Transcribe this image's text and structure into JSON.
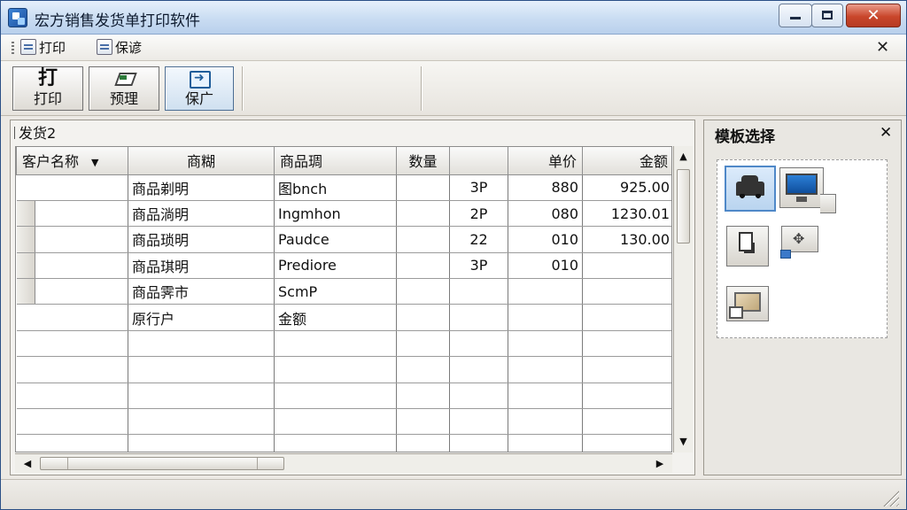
{
  "window": {
    "title": "宏方销售发货单打印软件",
    "controls": {
      "minimize": "—",
      "maximize": "□",
      "close": "✕"
    }
  },
  "menu": {
    "items": [
      {
        "label": "打印",
        "icon": "print-doc-icon"
      },
      {
        "label": "保谚",
        "icon": "save-doc-icon"
      }
    ],
    "close": "✕"
  },
  "toolbar": {
    "print": {
      "big": "打",
      "label": "打印"
    },
    "preview": {
      "label": "预理"
    },
    "save": {
      "label": "保广"
    }
  },
  "grid": {
    "panel_title": "发货2",
    "columns": [
      "客户名称",
      "商糊",
      "商品琱",
      "数量",
      "",
      "单价",
      "金额"
    ],
    "rows": [
      [
        "",
        "商品剃明",
        "图bnch",
        "",
        "3P",
        "880",
        "925.00"
      ],
      [
        "",
        "商品淌明",
        "Ingmhon",
        "",
        "2P",
        "080",
        "1230.01"
      ],
      [
        "",
        "商品琐明",
        "Paudce",
        "",
        "22",
        "010",
        "130.00"
      ],
      [
        "",
        "商品琪明",
        "Prediore",
        "",
        "3P",
        "010",
        ""
      ],
      [
        "",
        "商品霁市",
        "ScmP",
        "",
        "",
        "",
        ""
      ],
      [
        "",
        "原行户",
        "金额",
        "",
        "",
        "",
        ""
      ],
      [
        "",
        "",
        "",
        "",
        "",
        "",
        ""
      ],
      [
        "",
        "",
        "",
        "",
        "",
        "",
        ""
      ],
      [
        "",
        "",
        "",
        "",
        "",
        "",
        ""
      ],
      [
        "",
        "",
        "",
        "",
        "",
        "",
        ""
      ],
      [
        "",
        "",
        "",
        "",
        "",
        "",
        ""
      ]
    ],
    "dropdown_arrow": "▼"
  },
  "scroll": {
    "up": "▲",
    "down": "▼",
    "left": "◀",
    "right": "▶"
  },
  "template_panel": {
    "title": "模板选择",
    "close": "✕",
    "items": [
      "car-template-icon",
      "monitor-template-icon",
      "document-template-icon",
      "move-template-icon",
      "picture-template-icon"
    ]
  },
  "colors": {
    "titlebar": "#c9dcf2",
    "close_button": "#c9462b",
    "window_bg": "#ece9e4",
    "selected_template_border": "#4f88c8"
  }
}
